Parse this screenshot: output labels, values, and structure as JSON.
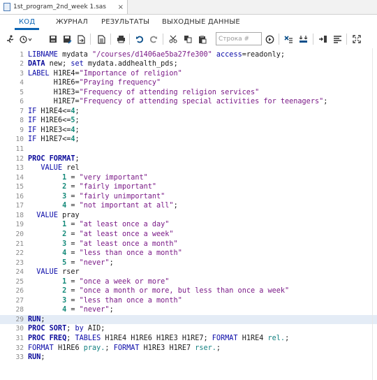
{
  "file_tab": {
    "name": "1st_program_2nd_week 1.sas",
    "close_glyph": "×"
  },
  "tabs": [
    {
      "label": "КОД",
      "active": true
    },
    {
      "label": "ЖУРНАЛ",
      "active": false
    },
    {
      "label": "РЕЗУЛЬТАТЫ",
      "active": false
    },
    {
      "label": "ВЫХОДНЫЕ ДАННЫЕ",
      "active": false
    }
  ],
  "toolbar": {
    "line_search_placeholder": "Строка #",
    "buttons": [
      "run-icon",
      "history-icon",
      "save-icon",
      "save-as-icon",
      "export-icon",
      "print-icon",
      "undo-icon",
      "redo-icon",
      "cut-icon",
      "copy-icon",
      "paste-icon",
      "go-icon",
      "clear-icon",
      "format-icon",
      "insert-icon",
      "list-icon",
      "maximize-icon"
    ]
  },
  "colors": {
    "accent": "#0b64b4",
    "keyword": "#0a0aa8",
    "string": "#7a1a87",
    "number": "#158a7a",
    "current_line": "#e4ecf6"
  },
  "current_line": 29,
  "code_lines": [
    [
      [
        "kw",
        "LIBNAME"
      ],
      [
        "t",
        " mydata "
      ],
      [
        "str",
        "\"/courses/d1406ae5ba27fe300\""
      ],
      [
        "t",
        " "
      ],
      [
        "kw",
        "access"
      ],
      [
        "t",
        "=readonly;"
      ]
    ],
    [
      [
        "kwb",
        "DATA"
      ],
      [
        "t",
        " new; "
      ],
      [
        "kw",
        "set"
      ],
      [
        "t",
        " mydata.addhealth_pds;"
      ]
    ],
    [
      [
        "kw",
        "LABEL"
      ],
      [
        "t",
        " H1RE4="
      ],
      [
        "str",
        "\"Importance of religion\""
      ]
    ],
    [
      [
        "t",
        "      H1RE6="
      ],
      [
        "str",
        "\"Praying frequency\""
      ]
    ],
    [
      [
        "t",
        "      H1RE3="
      ],
      [
        "str",
        "\"Frequency of attending religion services\""
      ]
    ],
    [
      [
        "t",
        "      H1RE7="
      ],
      [
        "str",
        "\"Frequency of attending special activities for teenagers\""
      ],
      [
        "t",
        ";"
      ]
    ],
    [
      [
        "kw",
        "IF"
      ],
      [
        "t",
        " H1RE4<="
      ],
      [
        "num",
        "4"
      ],
      [
        "t",
        ";"
      ]
    ],
    [
      [
        "kw",
        "IF"
      ],
      [
        "t",
        " H1RE6<="
      ],
      [
        "num",
        "5"
      ],
      [
        "t",
        ";"
      ]
    ],
    [
      [
        "kw",
        "IF"
      ],
      [
        "t",
        " H1RE3<="
      ],
      [
        "num",
        "4"
      ],
      [
        "t",
        ";"
      ]
    ],
    [
      [
        "kw",
        "IF"
      ],
      [
        "t",
        " H1RE7<="
      ],
      [
        "num",
        "4"
      ],
      [
        "t",
        ";"
      ]
    ],
    [],
    [
      [
        "kwb",
        "PROC FORMAT"
      ],
      [
        "t",
        ";"
      ]
    ],
    [
      [
        "t",
        "   "
      ],
      [
        "kw",
        "VALUE"
      ],
      [
        "t",
        " rel"
      ]
    ],
    [
      [
        "t",
        "        "
      ],
      [
        "num",
        "1"
      ],
      [
        "t",
        " = "
      ],
      [
        "str",
        "\"very important\""
      ]
    ],
    [
      [
        "t",
        "        "
      ],
      [
        "num",
        "2"
      ],
      [
        "t",
        " = "
      ],
      [
        "str",
        "\"fairly important\""
      ]
    ],
    [
      [
        "t",
        "        "
      ],
      [
        "num",
        "3"
      ],
      [
        "t",
        " = "
      ],
      [
        "str",
        "\"fairly unimportant\""
      ]
    ],
    [
      [
        "t",
        "        "
      ],
      [
        "num",
        "4"
      ],
      [
        "t",
        " = "
      ],
      [
        "str",
        "\"not important at all\""
      ],
      [
        "t",
        ";"
      ]
    ],
    [
      [
        "t",
        "  "
      ],
      [
        "kw",
        "VALUE"
      ],
      [
        "t",
        " pray"
      ]
    ],
    [
      [
        "t",
        "        "
      ],
      [
        "num",
        "1"
      ],
      [
        "t",
        " = "
      ],
      [
        "str",
        "\"at least once a day\""
      ]
    ],
    [
      [
        "t",
        "        "
      ],
      [
        "num",
        "2"
      ],
      [
        "t",
        " = "
      ],
      [
        "str",
        "\"at least once a week\""
      ]
    ],
    [
      [
        "t",
        "        "
      ],
      [
        "num",
        "3"
      ],
      [
        "t",
        " = "
      ],
      [
        "str",
        "\"at least once a month\""
      ]
    ],
    [
      [
        "t",
        "        "
      ],
      [
        "num",
        "4"
      ],
      [
        "t",
        " = "
      ],
      [
        "str",
        "\"less than once a month\""
      ]
    ],
    [
      [
        "t",
        "        "
      ],
      [
        "num",
        "5"
      ],
      [
        "t",
        " = "
      ],
      [
        "str",
        "\"never\""
      ],
      [
        "t",
        ";"
      ]
    ],
    [
      [
        "t",
        "  "
      ],
      [
        "kw",
        "VALUE"
      ],
      [
        "t",
        " rser"
      ]
    ],
    [
      [
        "t",
        "        "
      ],
      [
        "num",
        "1"
      ],
      [
        "t",
        " = "
      ],
      [
        "str",
        "\"once a week or more\""
      ]
    ],
    [
      [
        "t",
        "        "
      ],
      [
        "num",
        "2"
      ],
      [
        "t",
        " = "
      ],
      [
        "str",
        "\"once a month or more, but less than once a week\""
      ]
    ],
    [
      [
        "t",
        "        "
      ],
      [
        "num",
        "3"
      ],
      [
        "t",
        " = "
      ],
      [
        "str",
        "\"less than once a month\""
      ]
    ],
    [
      [
        "t",
        "        "
      ],
      [
        "num",
        "4"
      ],
      [
        "t",
        " = "
      ],
      [
        "str",
        "\"never\""
      ],
      [
        "t",
        ";"
      ]
    ],
    [
      [
        "kwb",
        "RUN"
      ],
      [
        "t",
        ";"
      ]
    ],
    [
      [
        "kwb",
        "PROC SORT"
      ],
      [
        "t",
        "; "
      ],
      [
        "kw",
        "by"
      ],
      [
        "t",
        " AID;"
      ]
    ],
    [
      [
        "kwb",
        "PROC FREQ"
      ],
      [
        "t",
        "; "
      ],
      [
        "kw",
        "TABLES"
      ],
      [
        "t",
        " H1RE4 H1RE6 H1RE3 H1RE7; "
      ],
      [
        "kw",
        "FORMAT"
      ],
      [
        "t",
        " H1RE4 "
      ],
      [
        "fmt",
        "rel."
      ],
      [
        "t",
        ";"
      ]
    ],
    [
      [
        "kw",
        "FORMAT"
      ],
      [
        "t",
        " H1RE6 "
      ],
      [
        "fmt",
        "pray."
      ],
      [
        "t",
        "; "
      ],
      [
        "kw",
        "FORMAT"
      ],
      [
        "t",
        " H1RE3 H1RE7 "
      ],
      [
        "fmt",
        "rser."
      ],
      [
        "t",
        ";"
      ]
    ],
    [
      [
        "kwb",
        "RUN"
      ],
      [
        "t",
        ";"
      ]
    ]
  ]
}
